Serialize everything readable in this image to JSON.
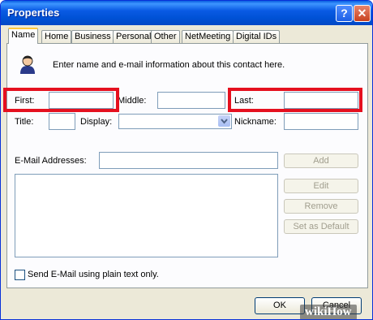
{
  "window": {
    "title": "Properties",
    "help_label": "?",
    "close_label": "✕"
  },
  "tabs": [
    {
      "label": "Name"
    },
    {
      "label": "Home"
    },
    {
      "label": "Business"
    },
    {
      "label": "Personal"
    },
    {
      "label": "Other"
    },
    {
      "label": "NetMeeting"
    },
    {
      "label": "Digital IDs"
    }
  ],
  "intro": {
    "text": "Enter name and e-mail information about this contact here.",
    "icon": "contact-person-icon"
  },
  "fields": {
    "first": {
      "label": "First:",
      "value": ""
    },
    "middle": {
      "label": "Middle:",
      "value": ""
    },
    "last": {
      "label": "Last:",
      "value": ""
    },
    "title": {
      "label": "Title:",
      "value": ""
    },
    "display": {
      "label": "Display:",
      "value": ""
    },
    "nickname": {
      "label": "Nickname:",
      "value": ""
    },
    "email": {
      "label": "E-Mail Addresses:",
      "value": ""
    }
  },
  "email_buttons": {
    "add": "Add",
    "edit": "Edit",
    "remove": "Remove",
    "set_default": "Set as Default"
  },
  "plain_text_checkbox": {
    "label": "Send E-Mail using plain text only.",
    "checked": false
  },
  "footer": {
    "ok": "OK",
    "cancel": "Cancel"
  },
  "watermark": "wikiHow",
  "colors": {
    "highlight": "#e5101f",
    "titlebar": "#0a5ae4",
    "dialog_bg": "#ece9d8"
  }
}
